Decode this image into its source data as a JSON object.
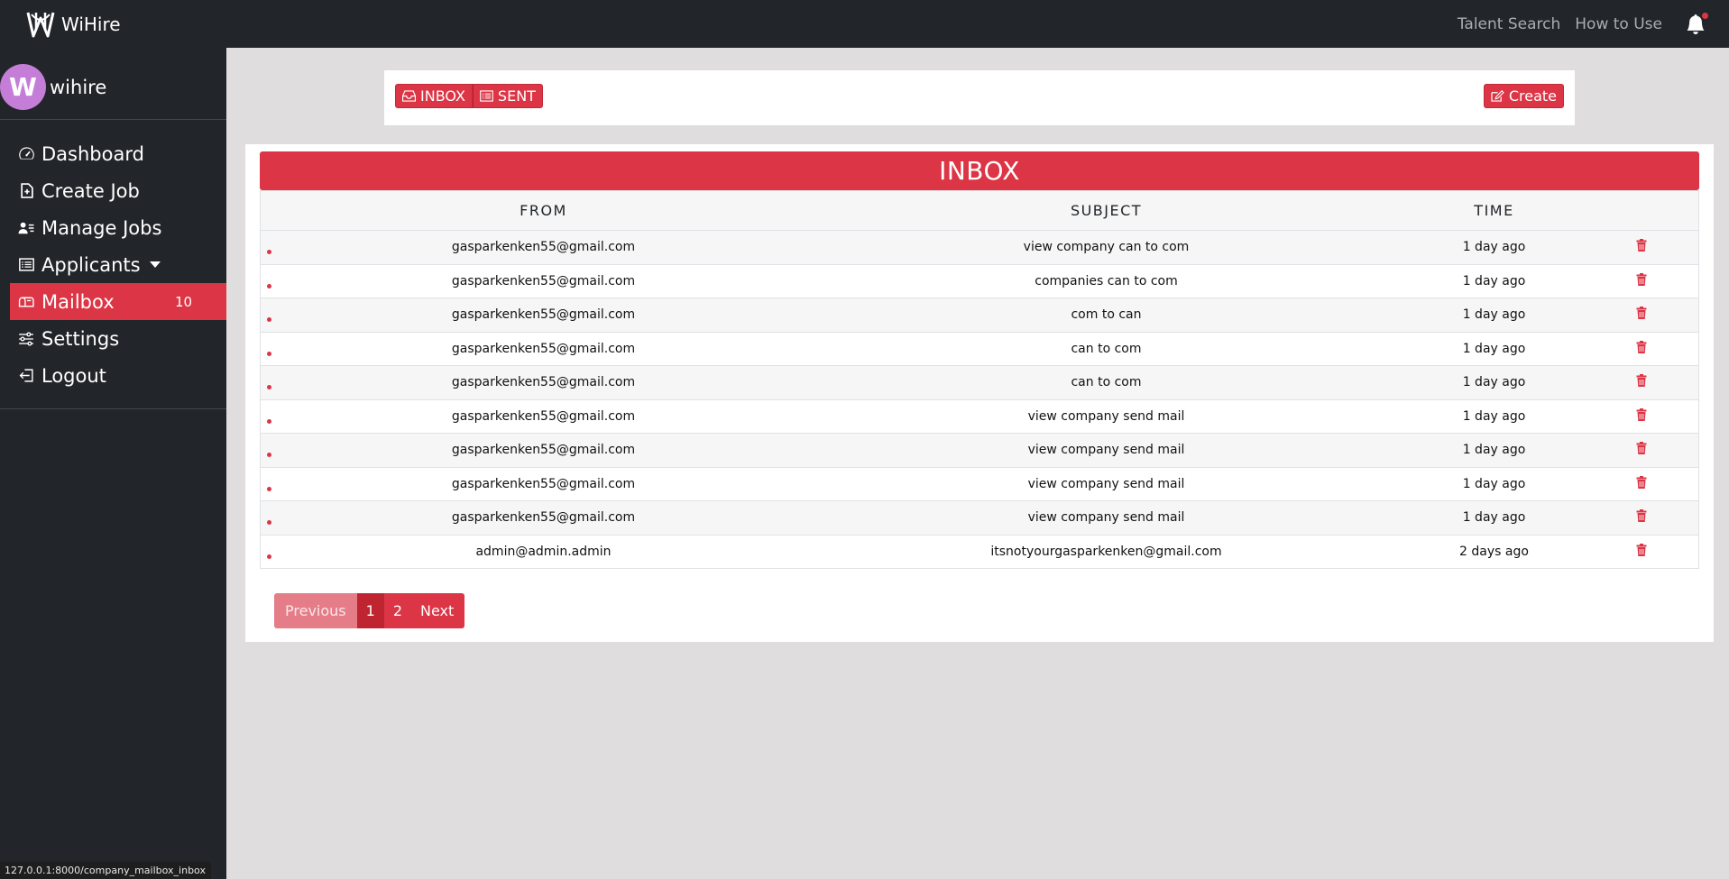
{
  "topbar": {
    "brand": "WiHire",
    "links": [
      "Talent Search",
      "How to Use"
    ]
  },
  "sidebar": {
    "avatar_letter": "W",
    "username": "wihire",
    "items": [
      {
        "label": "Dashboard",
        "icon": "speedometer-icon"
      },
      {
        "label": "Create Job",
        "icon": "file-plus-icon"
      },
      {
        "label": "Manage Jobs",
        "icon": "person-lines-icon"
      },
      {
        "label": "Applicants",
        "icon": "list-card-icon"
      },
      {
        "label": "Mailbox",
        "icon": "mailbox-icon",
        "badge": "10"
      },
      {
        "label": "Settings",
        "icon": "sliders-icon"
      },
      {
        "label": "Logout",
        "icon": "box-arrow-left-icon"
      }
    ]
  },
  "toolbar": {
    "inbox_label": "INBOX",
    "sent_label": "SENT",
    "create_label": "Create"
  },
  "inbox": {
    "title": "INBOX",
    "columns": [
      "FROM",
      "SUBJECT",
      "TIME"
    ],
    "rows": [
      {
        "from": "gasparkenken55@gmail.com",
        "subject": "view company can to com",
        "time": "1 day ago"
      },
      {
        "from": "gasparkenken55@gmail.com",
        "subject": "companies can to com",
        "time": "1 day ago"
      },
      {
        "from": "gasparkenken55@gmail.com",
        "subject": "com to can",
        "time": "1 day ago"
      },
      {
        "from": "gasparkenken55@gmail.com",
        "subject": "can to com",
        "time": "1 day ago"
      },
      {
        "from": "gasparkenken55@gmail.com",
        "subject": "can to com",
        "time": "1 day ago"
      },
      {
        "from": "gasparkenken55@gmail.com",
        "subject": "view company send mail",
        "time": "1 day ago"
      },
      {
        "from": "gasparkenken55@gmail.com",
        "subject": "view company send mail",
        "time": "1 day ago"
      },
      {
        "from": "gasparkenken55@gmail.com",
        "subject": "view company send mail",
        "time": "1 day ago"
      },
      {
        "from": "gasparkenken55@gmail.com",
        "subject": "view company send mail",
        "time": "1 day ago"
      },
      {
        "from": "admin@admin.admin",
        "subject": "itsnotyourgasparkenken@gmail.com",
        "time": "2 days ago"
      }
    ]
  },
  "pagination": {
    "previous": "Previous",
    "pages": [
      "1",
      "2"
    ],
    "next": "Next"
  },
  "status_url": "127.0.0.1:8000/company_mailbox_inbox",
  "colors": {
    "accent": "#dc3545",
    "sidebar_bg": "#22252a",
    "page_bg": "#dfdddd"
  }
}
